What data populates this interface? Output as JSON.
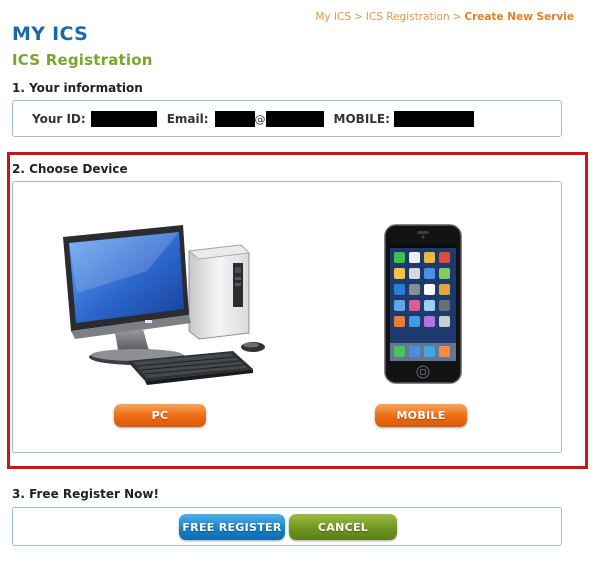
{
  "breadcrumb": {
    "items": [
      "My ICS",
      "ICS Registration"
    ],
    "separator": ">",
    "current": "Create New Servie"
  },
  "header": {
    "title": "MY ICS",
    "subtitle": "ICS Registration"
  },
  "section1": {
    "heading": "1. Your information",
    "id_label": "Your ID:",
    "email_label": "Email:",
    "email_at": "@",
    "mobile_label": "MOBILE:"
  },
  "section2": {
    "heading": "2. Choose Device",
    "pc_button": "PC",
    "mobile_button": "MOBILE"
  },
  "section3": {
    "heading": "3. Free Register Now!",
    "register_button": "FREE REGISTER",
    "cancel_button": "CANCEL"
  },
  "colors": {
    "title_blue": "#1c69a8",
    "subtitle_green": "#7aa52b",
    "breadcrumb_orange": "#e8954a",
    "highlight_red": "#d0121b"
  }
}
